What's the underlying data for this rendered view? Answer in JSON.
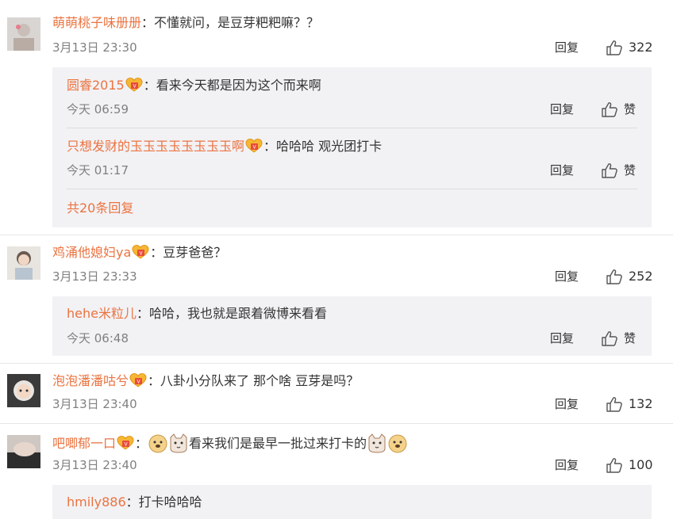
{
  "comments": [
    {
      "user": "萌萌桃子味册册",
      "sep": "：",
      "text": "不懂就问，是豆芽粑粑嘛？？",
      "time": "3月13日 23:30",
      "reply_label": "回复",
      "likes": "322",
      "replies": [
        {
          "user": "圆睿2015",
          "sep": "：",
          "text": "看来今天都是因为这个而来啊",
          "time": "今天 06:59",
          "reply_label": "回复",
          "like_label": "赞"
        },
        {
          "user": "只想发财的玉玉玉玉玉玉玉玉啊",
          "sep": "：",
          "text": "哈哈哈  观光团打卡",
          "time": "今天 01:17",
          "reply_label": "回复",
          "like_label": "赞"
        }
      ],
      "more": "共20条回复"
    },
    {
      "user": "鸡涌他媳妇ya",
      "sep": "：",
      "text": "豆芽爸爸？",
      "time": "3月13日 23:33",
      "reply_label": "回复",
      "likes": "252",
      "replies": [
        {
          "user": "hehe米粒儿",
          "sep": "：",
          "text": "哈哈，我也就是跟着微博来看看",
          "time": "今天 06:48",
          "reply_label": "回复",
          "like_label": "赞"
        }
      ]
    },
    {
      "user": "泡泡潘潘咕兮",
      "sep": "：",
      "text": "八卦小分队来了 那个啥 豆芽是吗？",
      "time": "3月13日 23:40",
      "reply_label": "回复",
      "likes": "132"
    },
    {
      "user": "吧唧郁一口",
      "sep": "：",
      "text": "看来我们是最早一批过来打卡的",
      "time": "3月13日 23:40",
      "reply_label": "回复",
      "likes": "100",
      "replies": [
        {
          "user": "hmily886",
          "sep": "：",
          "text": "打卡哈哈哈"
        }
      ]
    }
  ],
  "colors": {
    "username": "#eb7340",
    "meta": "#808080",
    "reply_bg": "#f2f2f5"
  }
}
